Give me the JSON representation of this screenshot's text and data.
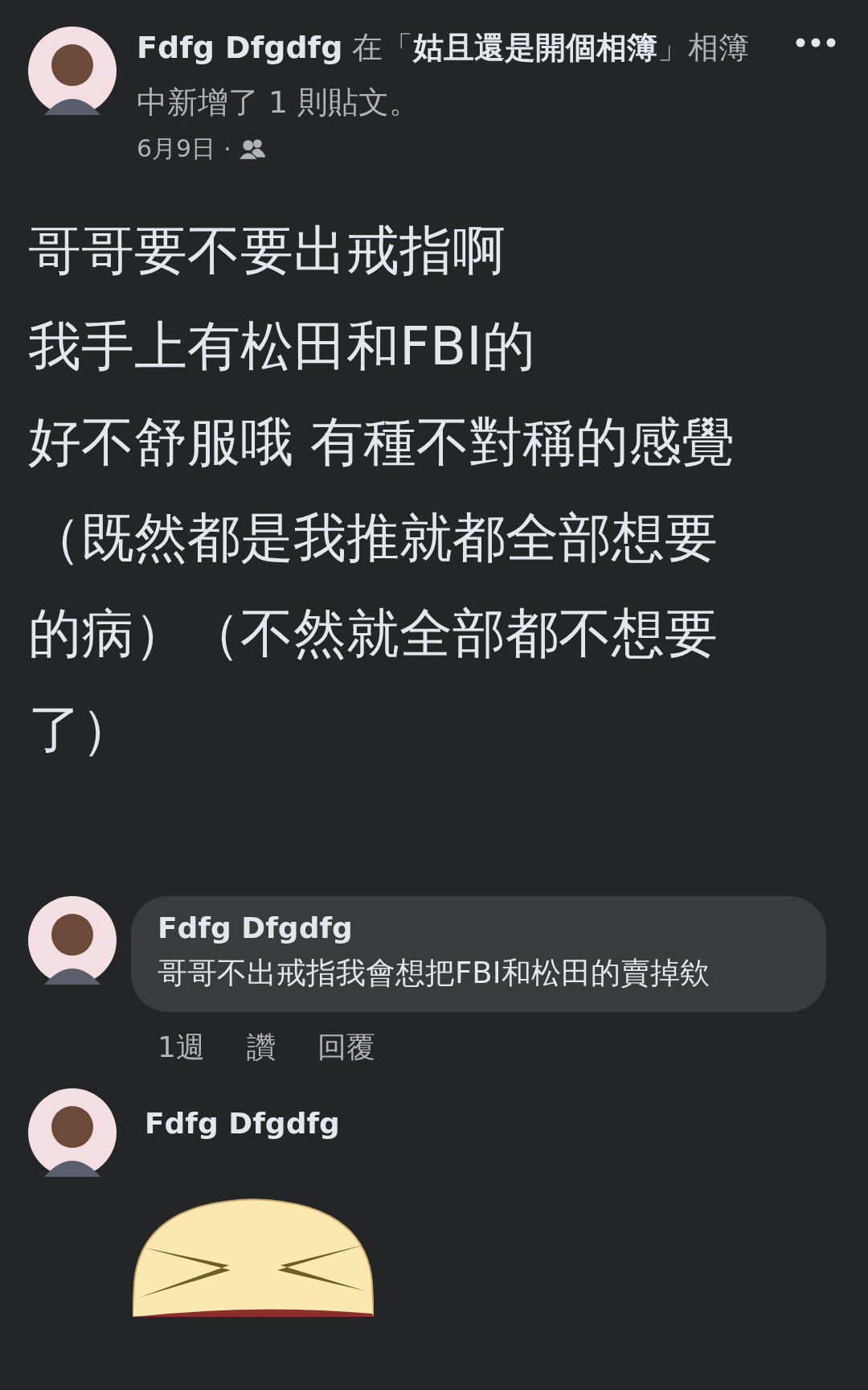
{
  "post": {
    "header": "**Fdfg Dfgdfg** 在「**姑且還是開個相簿**」相簿中新增了 1 則貼文。",
    "date": "6月9日",
    "separator": "·",
    "body_lines": [
      "哥哥要不要出戒指啊",
      "我手上有松田和FBI的",
      "好不舒服哦 有種不對稱的感覺",
      "（既然都是我推就都全部想要",
      "的病）（不然就全部都不想要",
      "了）"
    ]
  },
  "comments": [
    {
      "kind": "text",
      "author": "Fdfg Dfgdfg",
      "text": "哥哥不出戒指我會想把FBI和松田的賣掉欸",
      "actions": [
        "1週",
        "讚",
        "回覆"
      ]
    },
    {
      "kind": "sticker",
      "author": "Fdfg Dfgdfg"
    }
  ]
}
